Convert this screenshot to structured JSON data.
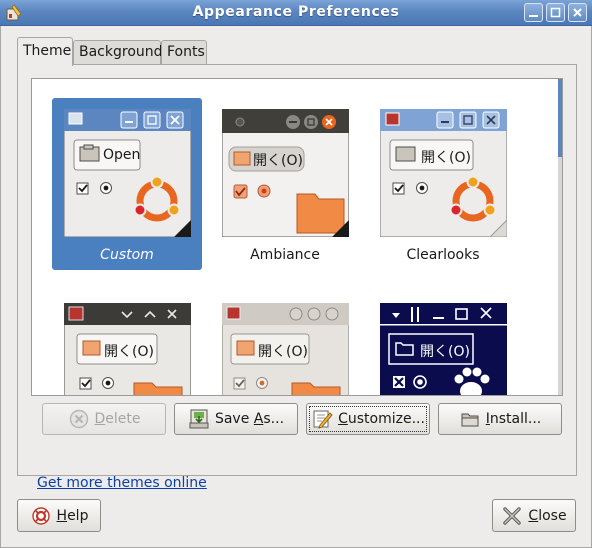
{
  "window": {
    "title": "Appearance Preferences"
  },
  "tabs": [
    {
      "label": "Theme",
      "active": true
    },
    {
      "label": "Background",
      "active": false
    },
    {
      "label": "Fonts",
      "active": false
    }
  ],
  "themes": [
    {
      "name": "Custom",
      "selected": true,
      "open_label": "Open"
    },
    {
      "name": "Ambiance",
      "selected": false,
      "open_label": "開く(O)"
    },
    {
      "name": "Clearlooks",
      "selected": false,
      "open_label": "開く(O)"
    },
    {
      "name": "",
      "selected": false,
      "open_label": "開く(O)"
    },
    {
      "name": "",
      "selected": false,
      "open_label": "開く(O)"
    },
    {
      "name": "",
      "selected": false,
      "open_label": "開く(O)"
    }
  ],
  "actions": {
    "delete_pre": "",
    "delete_u": "D",
    "delete_post": "elete",
    "saveas_pre": "Save ",
    "saveas_u": "A",
    "saveas_post": "s...",
    "customize_pre": "",
    "customize_u": "C",
    "customize_post": "ustomize...",
    "install_pre": "",
    "install_u": "I",
    "install_post": "nstall..."
  },
  "more_themes_link": "Get more themes online",
  "footer": {
    "help_pre": "",
    "help_u": "H",
    "help_post": "elp",
    "close_pre": "",
    "close_u": "C",
    "close_post": "lose"
  },
  "colors": {
    "selection": "#4a7fc0",
    "titlebar": "#5b86c0",
    "link": "#0b3fa8"
  }
}
